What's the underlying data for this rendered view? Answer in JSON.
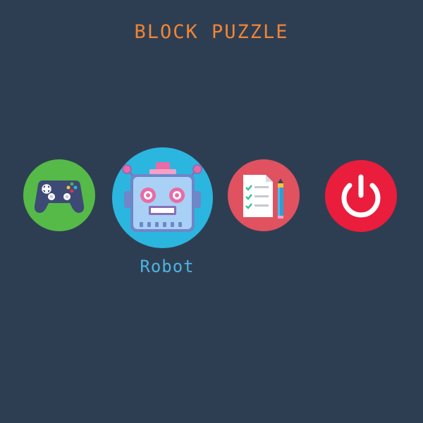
{
  "title": "BLOCK PUZZLE",
  "menu": {
    "items": [
      {
        "icon": "gamepad-icon",
        "color": "#55ba47"
      },
      {
        "icon": "robot-icon",
        "color": "#2bb6e0",
        "selected": true,
        "label": "Robot"
      },
      {
        "icon": "checklist-pencil-icon",
        "color": "#e05260"
      },
      {
        "icon": "power-icon",
        "color": "#ea1d3c"
      }
    ],
    "selected_label": "Robot"
  },
  "colors": {
    "background": "#2e3e52",
    "title": "#f08536",
    "label": "#4cb4e0"
  }
}
